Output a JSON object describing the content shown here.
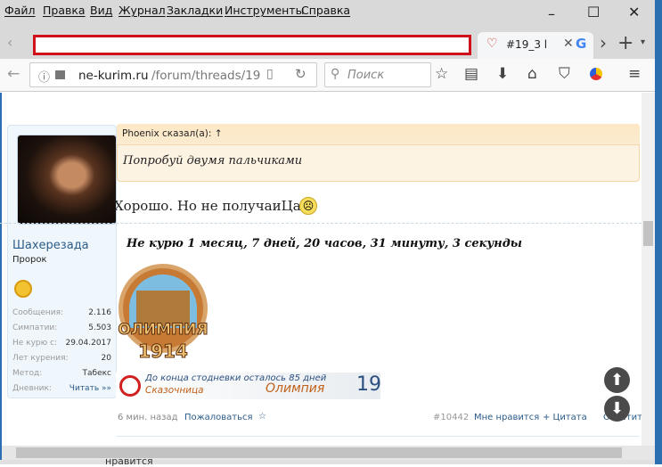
{
  "menu": [
    "Файл",
    "Правка",
    "Вид",
    "Журнал",
    "Закладки",
    "Инструменты",
    "Справка"
  ],
  "window_controls": {
    "minimize": "–",
    "maximize": "☐",
    "close": "✕"
  },
  "tab": {
    "title": "#19_3 l",
    "close": "✕"
  },
  "tabbar": {
    "new_tab": "+",
    "list": "▾",
    "scroll": "›"
  },
  "url": {
    "domain": "ne-kurim.ru",
    "path": "/forum/threads/19"
  },
  "search": {
    "placeholder": "Поиск"
  },
  "user": {
    "name": "Шахерезада",
    "title": "Пророк",
    "stats": [
      {
        "label": "Сообщения:",
        "value": "2.116"
      },
      {
        "label": "Симпатии:",
        "value": "5.503"
      },
      {
        "label": "Не курю с:",
        "value": "29.04.2017"
      },
      {
        "label": "Лет курения:",
        "value": "20"
      },
      {
        "label": "Метод:",
        "value": "Табекс"
      },
      {
        "label": "Дневник:",
        "value": "Читать »»"
      }
    ]
  },
  "quote": {
    "author": "Phoenix сказал(а): ↑",
    "text": "Попробуй двумя пальчиками"
  },
  "message": "Хорошо. Но не получаиЦа.",
  "signature": "Не курю 1 месяц, 7 дней, 20 часов, 31 минуту, 3 секунды",
  "logo": {
    "text": "ОЛИМПИЯ",
    "year": "1914"
  },
  "banner": {
    "line1": "До конца стодневки осталось 85 дней",
    "name": "Сказочница",
    "event": "Олимпия",
    "number": "19"
  },
  "footer": {
    "time": "6 мин. назад",
    "report": "Пожаловаться",
    "star": "☆",
    "post_id": "#10442",
    "like": "Мне нравится",
    "quote": "+ Цитата",
    "reply": "Ответить"
  },
  "below": "нравится"
}
